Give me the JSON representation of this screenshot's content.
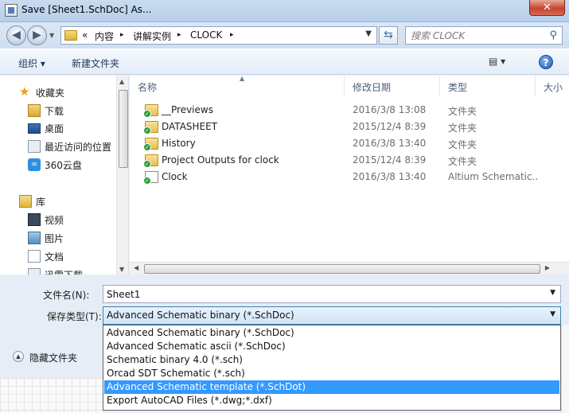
{
  "window": {
    "title": "Save [Sheet1.SchDoc] As...",
    "close_glyph": "✕"
  },
  "address": {
    "crumbs": [
      "«",
      "内容",
      "讲解实例",
      "CLOCK"
    ],
    "separator": "▸",
    "search_placeholder": "搜索 CLOCK"
  },
  "toolbar": {
    "organize_label": "组织 ▾",
    "new_folder_label": "新建文件夹",
    "view_label": "▤ ▾",
    "help_label": "?"
  },
  "nav": {
    "favorites": {
      "label": "收藏夹",
      "icon": "star-icon"
    },
    "fav_items": [
      {
        "label": "下载",
        "icon": "downloads-icon"
      },
      {
        "label": "桌面",
        "icon": "desktop-icon"
      },
      {
        "label": "最近访问的位置",
        "icon": "recent-places-icon"
      },
      {
        "label": "360云盘",
        "icon": "cloud-drive-icon"
      }
    ],
    "libraries": {
      "label": "库",
      "icon": "library-icon"
    },
    "lib_items": [
      {
        "label": "视频",
        "icon": "video-icon"
      },
      {
        "label": "图片",
        "icon": "pictures-icon"
      },
      {
        "label": "文档",
        "icon": "documents-icon"
      },
      {
        "label": "迅雷下载",
        "icon": "thunder-download-icon"
      }
    ]
  },
  "columns": {
    "name": "名称",
    "date": "修改日期",
    "type": "类型",
    "size": "大小"
  },
  "files": [
    {
      "name": "__Previews",
      "date": "2016/3/8 13:08",
      "type": "文件夹",
      "icon": "folder-icon"
    },
    {
      "name": "DATASHEET",
      "date": "2015/12/4 8:39",
      "type": "文件夹",
      "icon": "folder-icon"
    },
    {
      "name": "History",
      "date": "2016/3/8 13:40",
      "type": "文件夹",
      "icon": "folder-icon"
    },
    {
      "name": "Project Outputs for clock",
      "date": "2015/12/4 8:39",
      "type": "文件夹",
      "icon": "folder-icon"
    },
    {
      "name": "Clock",
      "date": "2016/3/8 13:40",
      "type": "Altium Schematic...",
      "icon": "schematic-file-icon"
    }
  ],
  "form": {
    "filename_label": "文件名(N):",
    "filename_value": "Sheet1",
    "filetype_label": "保存类型(T):",
    "filetype_value": "Advanced Schematic binary (*.SchDoc)",
    "filetype_options": [
      "Advanced Schematic binary (*.SchDoc)",
      "Advanced Schematic ascii (*.SchDoc)",
      "Schematic binary 4.0 (*.sch)",
      "Orcad SDT Schematic (*.sch)",
      "Advanced Schematic template (*.SchDot)",
      "Export AutoCAD Files (*.dwg;*.dxf)"
    ],
    "highlighted_option": "Advanced Schematic template (*.SchDot)",
    "hide_folders_label": "隐藏文件夹"
  }
}
